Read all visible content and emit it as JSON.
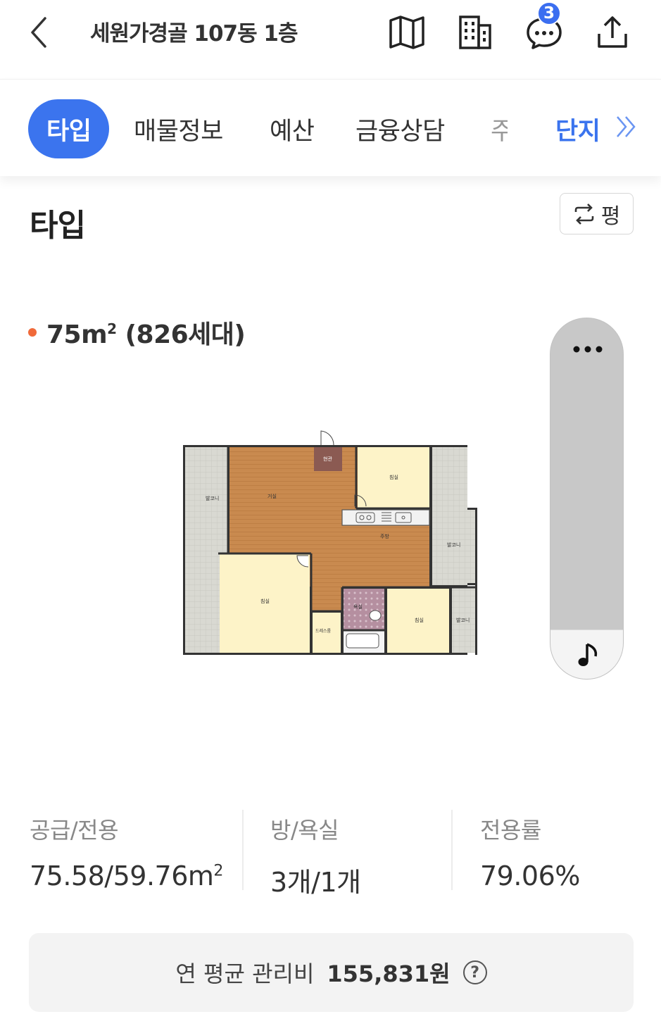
{
  "header": {
    "title": "세원가경골 107동 1층",
    "notification_count": "3",
    "icons": [
      "back-icon",
      "map-icon",
      "building-icon",
      "chat-icon",
      "share-icon"
    ]
  },
  "tabs": [
    {
      "label": "타입",
      "active": true
    },
    {
      "label": "매물정보"
    },
    {
      "label": "예산"
    },
    {
      "label": "금융상담"
    },
    {
      "label": "주"
    },
    {
      "label": "단지"
    }
  ],
  "section": {
    "title": "타입",
    "unit_toggle": "평"
  },
  "type_info": {
    "area": "75m",
    "area_sup": "2",
    "households": " (826세대)"
  },
  "floorplan_labels": {
    "living": "거실",
    "kitchen": "주방",
    "bedroom": "침실",
    "balcony": "발코니",
    "entrance": "현관",
    "bath": "욕실",
    "dress": "드레스룸"
  },
  "stats": [
    {
      "label": "공급/전용",
      "value": "75.58/59.76m",
      "sup": "2"
    },
    {
      "label": "방/욕실",
      "value": "3개/1개"
    },
    {
      "label": "전용률",
      "value": "79.06%"
    }
  ],
  "fee": {
    "label": "연 평균 관리비",
    "value": "155,831원",
    "help": "?"
  },
  "colors": {
    "accent": "#3b74ee",
    "dot": "#f06a3a",
    "floor_wood": "#c98a4f",
    "room": "#fdf3c8",
    "balcony": "#d9d9d2"
  }
}
